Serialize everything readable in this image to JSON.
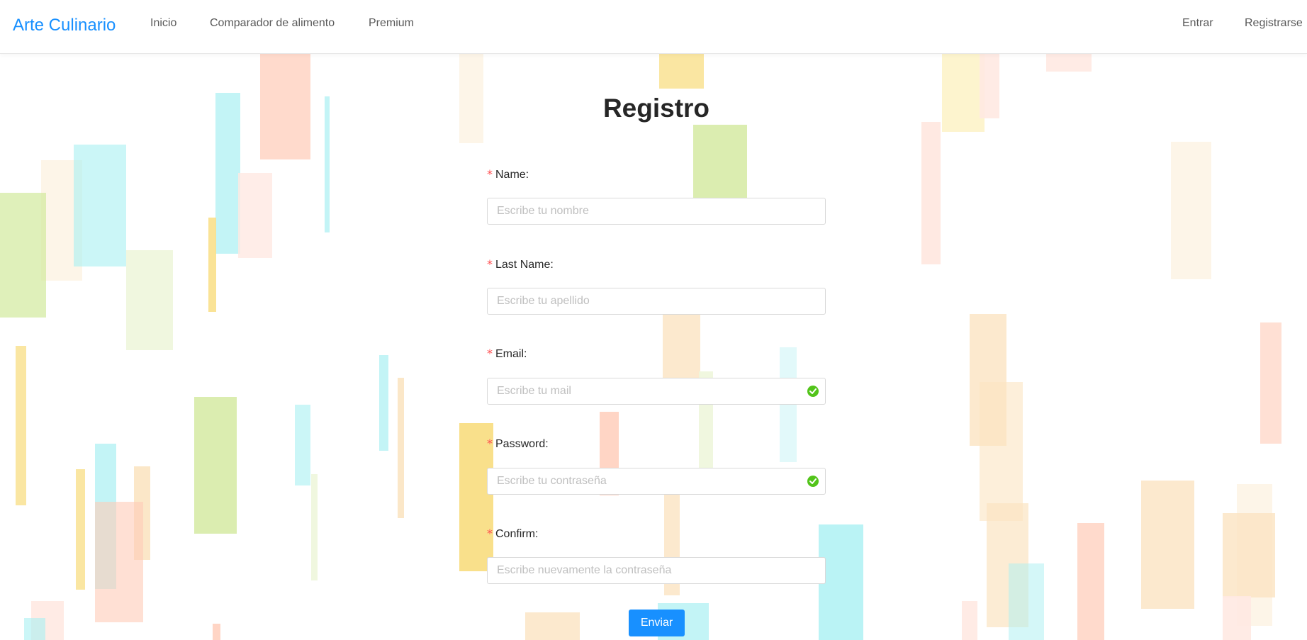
{
  "header": {
    "brand": "Arte Culinario",
    "nav": [
      {
        "label": "Inicio"
      },
      {
        "label": "Comparador de alimento"
      },
      {
        "label": "Premium"
      }
    ],
    "right": [
      {
        "label": "Entrar"
      },
      {
        "label": "Registrarse"
      }
    ]
  },
  "form": {
    "title": "Registro",
    "required_marker": "*",
    "fields": [
      {
        "label": "Name:",
        "placeholder": "Escribe tu nombre",
        "value": "",
        "validated": false
      },
      {
        "label": "Last Name:",
        "placeholder": "Escribe tu apellido",
        "value": "",
        "validated": false
      },
      {
        "label": "Email:",
        "placeholder": "Escribe tu mail",
        "value": "",
        "validated": true
      },
      {
        "label": "Password:",
        "placeholder": "Escribe tu contraseña",
        "value": "",
        "validated": true
      },
      {
        "label": "Confirm:",
        "placeholder": "Escribe nuevamente la contraseña",
        "value": "",
        "validated": false
      }
    ],
    "submit_label": "Enviar"
  },
  "colors": {
    "brand": "#1890ff",
    "required": "#ff4d4f",
    "success": "#52c41a",
    "border": "#d9d9d9",
    "placeholder": "#bfbfbf",
    "decor": [
      "#a9f0f2",
      "#ffcbb7",
      "#d2e99c",
      "#f9e08b",
      "#fbe4c2"
    ]
  },
  "icons": {
    "validation": "check-circle-icon"
  }
}
